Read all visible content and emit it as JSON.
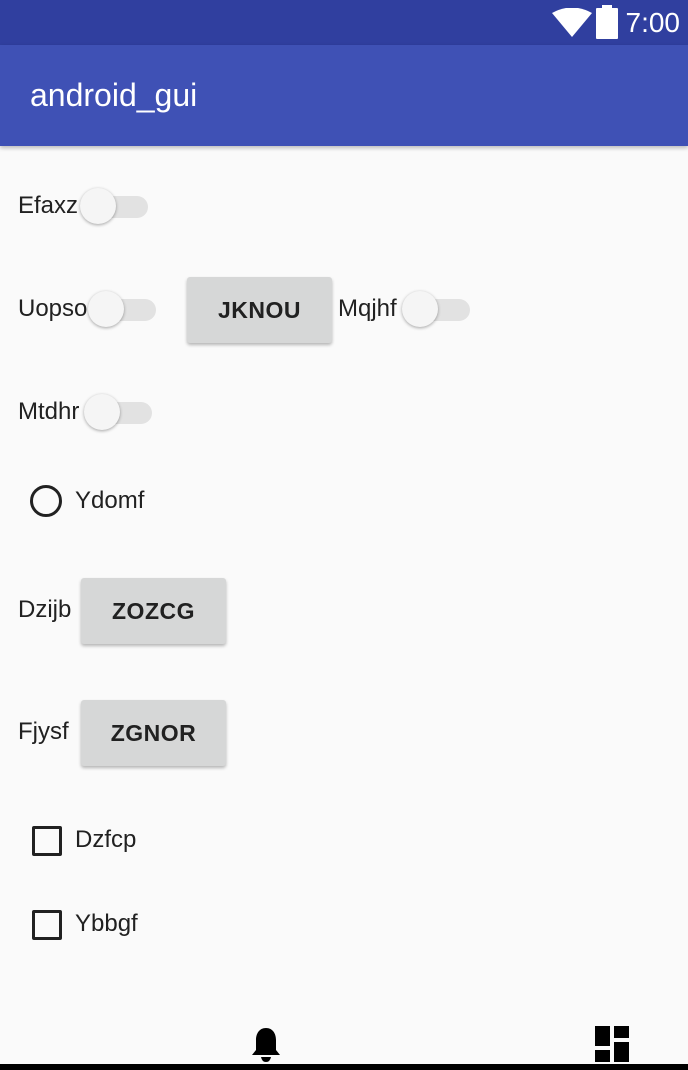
{
  "status_bar": {
    "time": "7:00",
    "icons": [
      "wifi-icon",
      "battery-icon"
    ]
  },
  "app_bar": {
    "title": "android_gui"
  },
  "content": {
    "switch_efaxz": {
      "label": "Efaxz",
      "checked": false
    },
    "switch_uopso": {
      "label": "Uopso",
      "checked": false
    },
    "button_jknou": {
      "label": "JKNOU"
    },
    "switch_mqjhf": {
      "label": "Mqjhf",
      "checked": false
    },
    "switch_mtdhr": {
      "label": "Mtdhr",
      "checked": false
    },
    "radio_ydomf": {
      "label": "Ydomf",
      "checked": false
    },
    "row_dzijb": {
      "label": "Dzijb",
      "button": "ZOZCG"
    },
    "row_fjysf": {
      "label": "Fjysf",
      "button": "ZGNOR"
    },
    "checkbox_dzfcp": {
      "label": "Dzfcp",
      "checked": false
    },
    "checkbox_ybbgf": {
      "label": "Ybbgf",
      "checked": false
    }
  },
  "bottom_bar": {
    "icons": [
      "bell-icon",
      "dashboard-icon"
    ]
  },
  "colors": {
    "status_bar": "#303f9f",
    "app_bar": "#3f51b5",
    "background": "#fafafa",
    "button": "#d6d7d7"
  }
}
